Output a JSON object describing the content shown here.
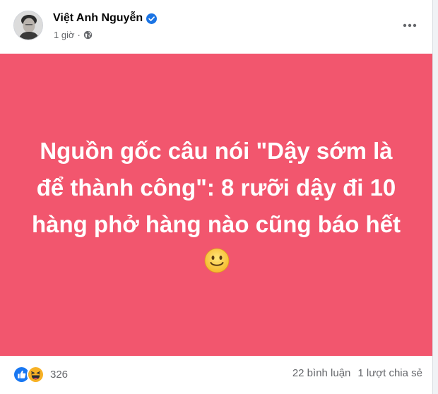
{
  "post": {
    "author": {
      "name": "Việt Anh Nguyễn",
      "verified": true
    },
    "time": "1 giờ",
    "privacy_icon": "globe-icon",
    "more_icon": "more-horizontal-icon",
    "banner": {
      "text": "Nguồn gốc câu nói \"Dậy sớm là để thành công\": 8 rưỡi dậy đi 10 hàng phở hàng nào cũng báo hết",
      "emoji": "slightly-smiling-face",
      "background_color": "#f2566e",
      "text_color": "#ffffff"
    },
    "reactions": {
      "icons": [
        "like-icon",
        "haha-icon"
      ],
      "count": "326"
    },
    "comments": "22 bình luận",
    "shares": "1 lượt chia sẻ"
  },
  "colors": {
    "verified_badge": "#1b74e4",
    "like": "#1877f2",
    "haha": "#f7b125",
    "secondary_text": "#65676b"
  }
}
